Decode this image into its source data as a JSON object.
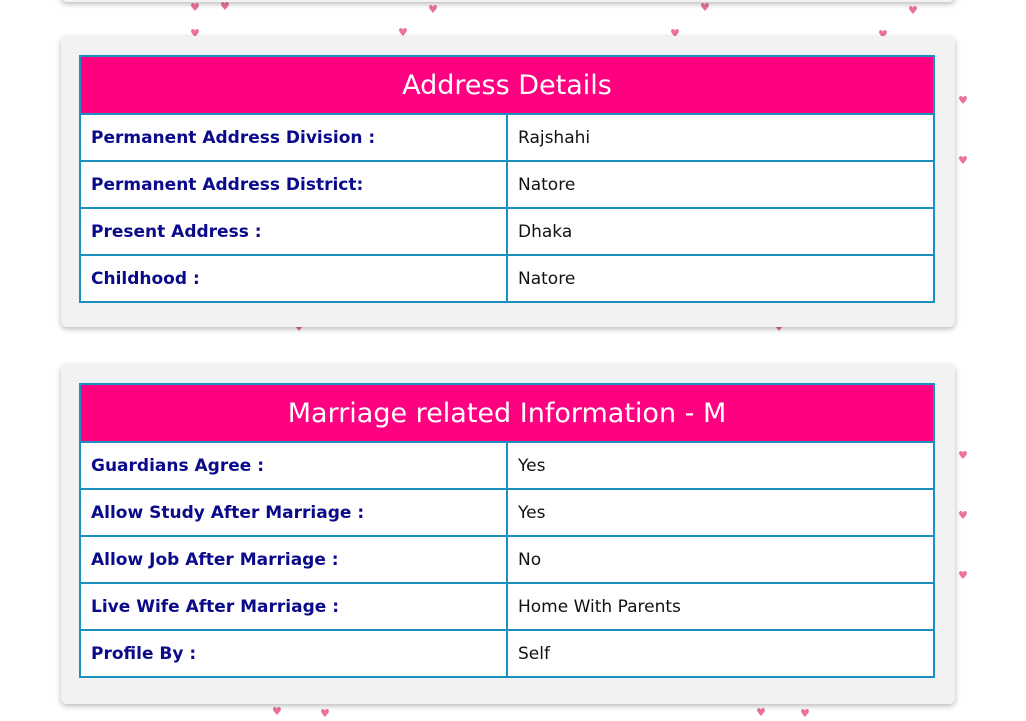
{
  "colors": {
    "header_bg": "#ff0080",
    "border": "#1b8fbf",
    "label_text": "#0a0a8a",
    "card_bg": "#f2f2f2",
    "heart": "#e85a8a"
  },
  "decoration": {
    "heart_glyph": "♥"
  },
  "address": {
    "title": "Address Details",
    "rows": [
      {
        "label": "Permanent Address Division :",
        "value": "Rajshahi"
      },
      {
        "label": "Permanent Address District:",
        "value": "Natore"
      },
      {
        "label": "Present Address :",
        "value": "Dhaka"
      },
      {
        "label": "Childhood :",
        "value": "Natore"
      }
    ]
  },
  "marriage": {
    "title": "Marriage related Information - M",
    "rows": [
      {
        "label": "Guardians Agree :",
        "value": "Yes"
      },
      {
        "label": "Allow Study After Marriage :",
        "value": "Yes"
      },
      {
        "label": "Allow Job After Marriage :",
        "value": "No"
      },
      {
        "label": "Live Wife After Marriage :",
        "value": "Home With Parents"
      },
      {
        "label": "Profile By :",
        "value": "Self"
      }
    ]
  }
}
